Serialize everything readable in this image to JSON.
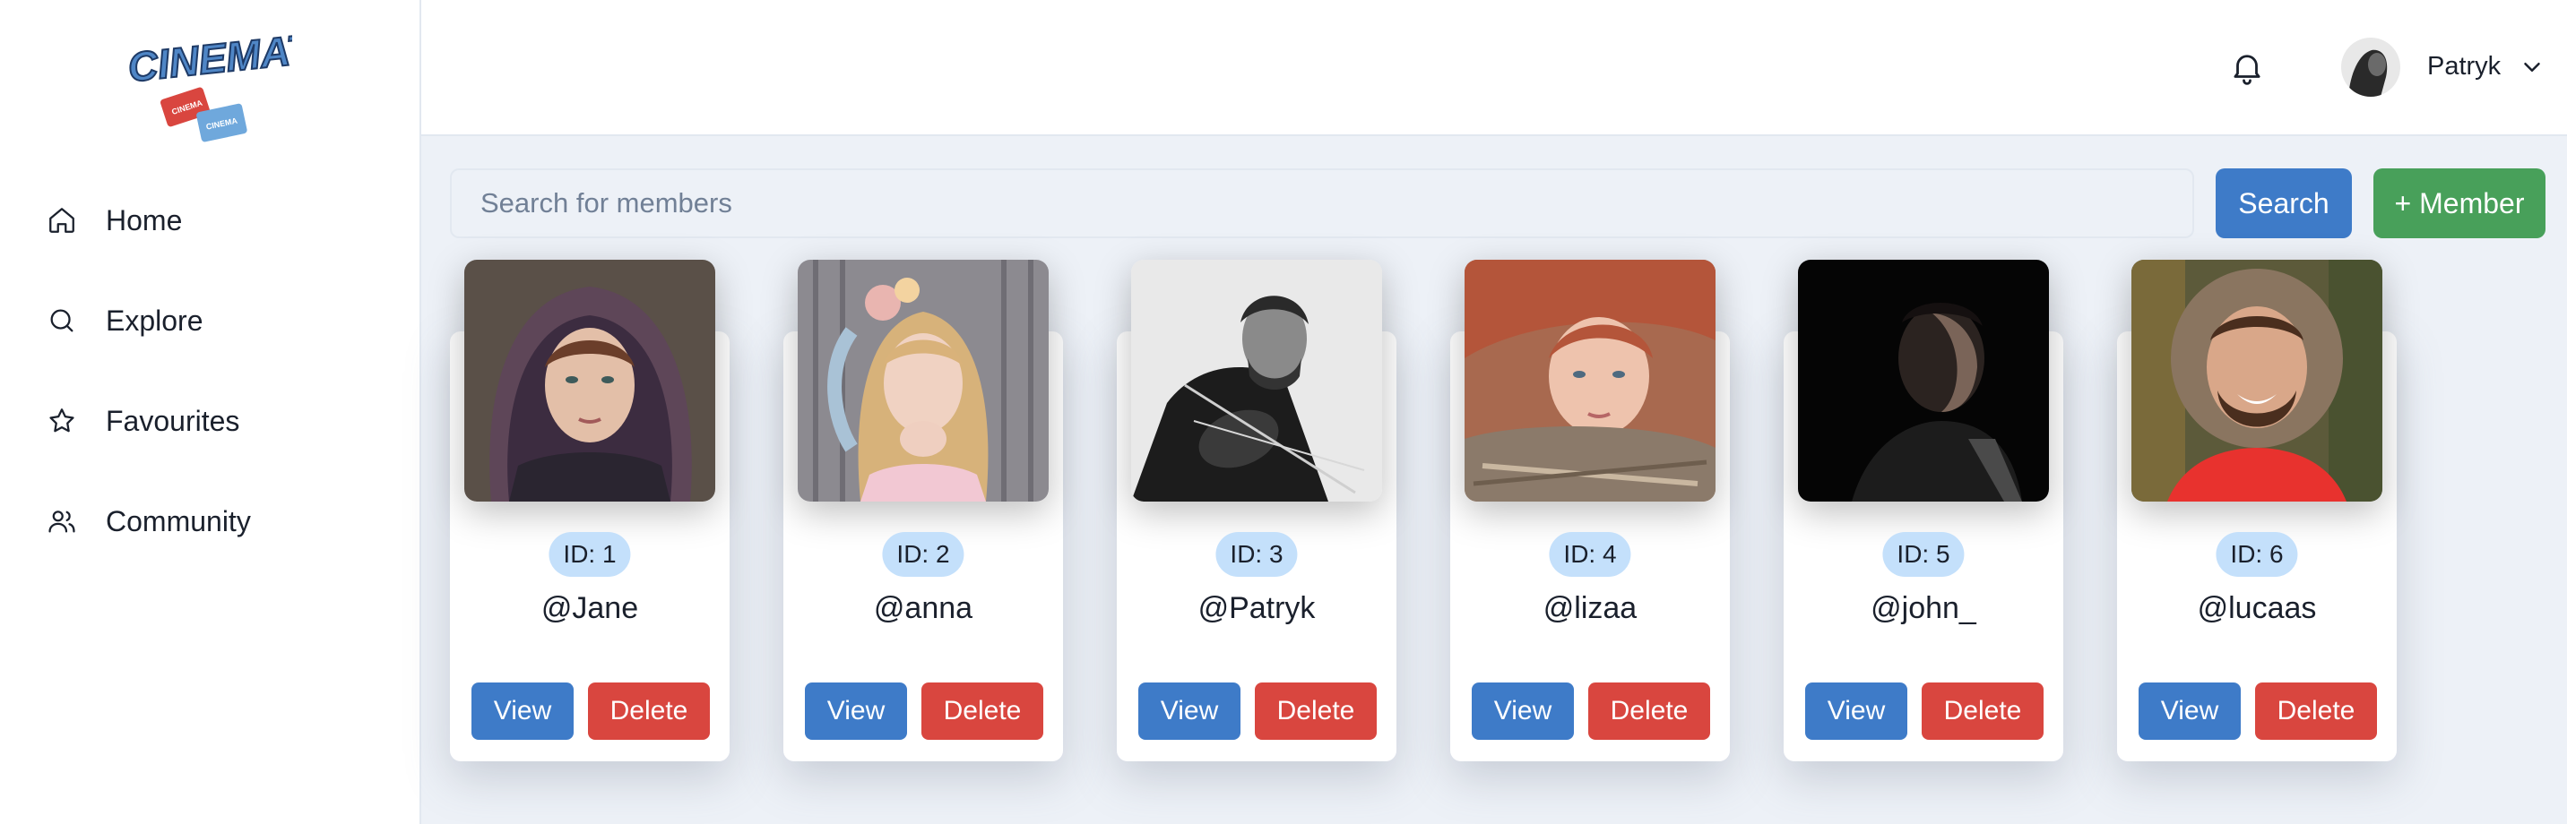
{
  "brand": {
    "logo_text": "CINEMATE",
    "ticket_text_1": "CINEMA",
    "ticket_text_2": "CINEMA"
  },
  "sidebar": {
    "items": [
      {
        "label": "Home",
        "icon": "home-icon"
      },
      {
        "label": "Explore",
        "icon": "search-icon"
      },
      {
        "label": "Favourites",
        "icon": "star-icon"
      },
      {
        "label": "Community",
        "icon": "users-icon"
      }
    ]
  },
  "topbar": {
    "user_name": "Patryk",
    "bell_icon": "bell-icon",
    "chevron_icon": "chevron-down-icon"
  },
  "search": {
    "placeholder": "Search for members",
    "value": "",
    "search_label": "Search",
    "add_member_label": "+ Member"
  },
  "members": [
    {
      "id_label": "ID: 1",
      "handle": "@Jane"
    },
    {
      "id_label": "ID: 2",
      "handle": "@anna"
    },
    {
      "id_label": "ID: 3",
      "handle": "@Patryk"
    },
    {
      "id_label": "ID: 4",
      "handle": "@lizaa"
    },
    {
      "id_label": "ID: 5",
      "handle": "@john_"
    },
    {
      "id_label": "ID: 6",
      "handle": "@lucaas"
    }
  ],
  "card_actions": {
    "view_label": "View",
    "delete_label": "Delete"
  },
  "colors": {
    "primary": "#3e7bc8",
    "success": "#48a05a",
    "danger": "#d9463f",
    "badge": "#c4e0fb",
    "background": "#edf1f7"
  }
}
